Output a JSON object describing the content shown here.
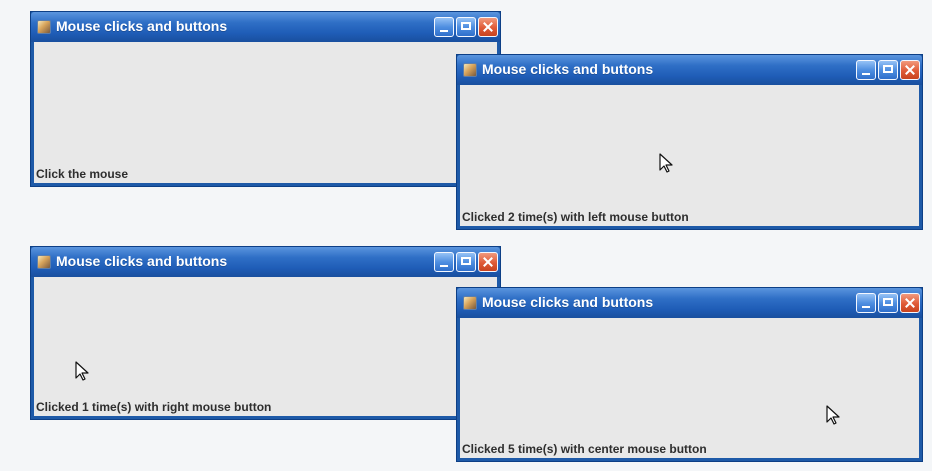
{
  "windows": [
    {
      "title": "Mouse clicks and buttons",
      "status": "Click the mouse"
    },
    {
      "title": "Mouse clicks and buttons",
      "status": "Clicked 2 time(s) with left mouse button"
    },
    {
      "title": "Mouse clicks and buttons",
      "status": "Clicked 1 time(s) with right mouse button"
    },
    {
      "title": "Mouse clicks and buttons",
      "status": "Clicked 5 time(s) with center mouse button"
    }
  ],
  "icons": {
    "app": "java-app-icon",
    "minimize": "minimize-icon",
    "maximize": "maximize-icon",
    "close": "close-icon",
    "cursor": "mouse-pointer-icon"
  },
  "colors": {
    "background": "#f4f6f8",
    "window_border": "#1e5aa8",
    "titlebar_top": "#5b95de",
    "titlebar_bottom": "#194f9e",
    "content": "#e8e8e8",
    "close_button": "#df5a37",
    "status_text": "#2e2e2e"
  }
}
